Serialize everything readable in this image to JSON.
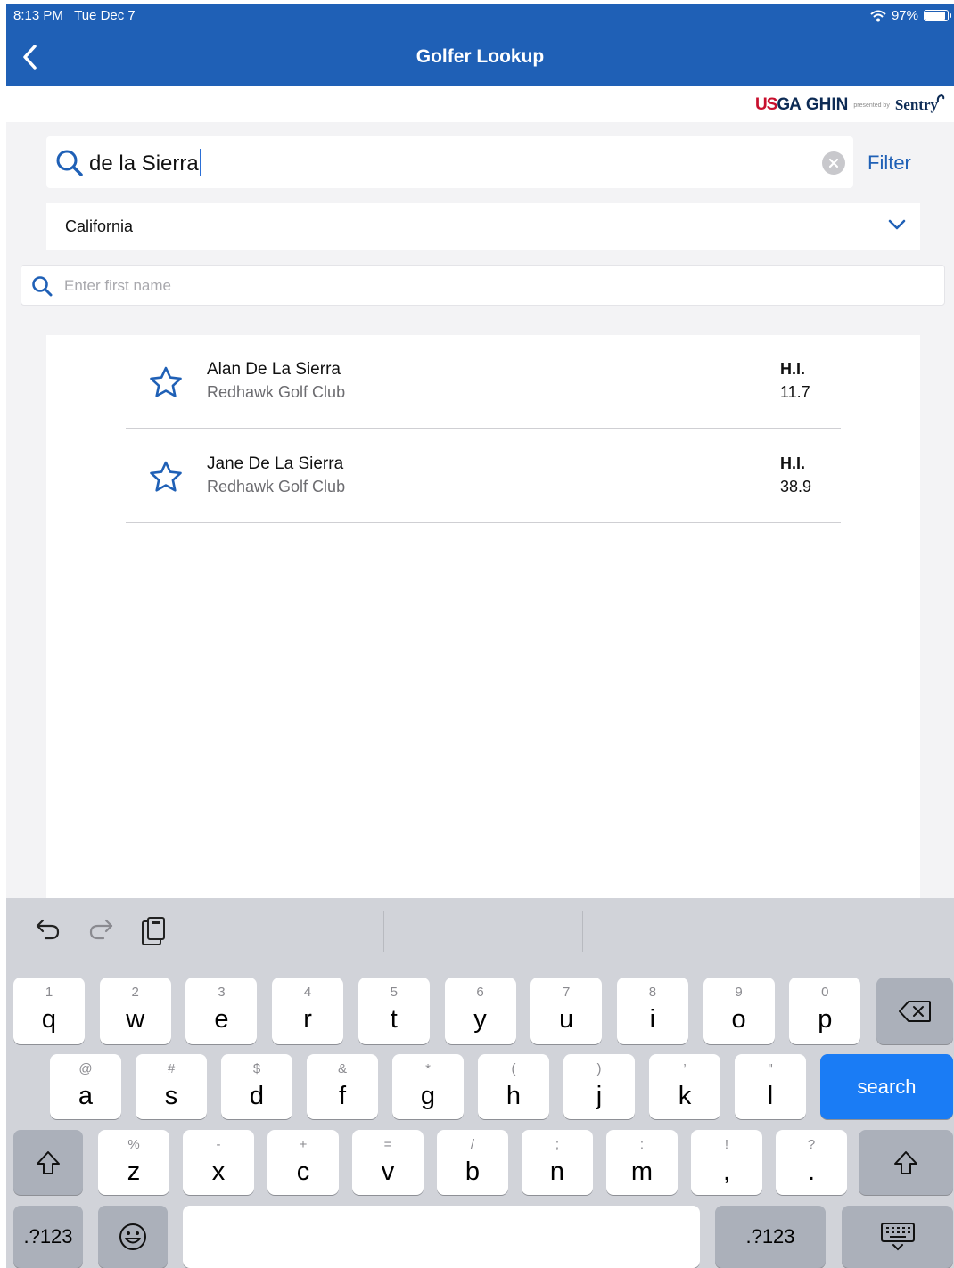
{
  "status_bar": {
    "time": "8:13 PM",
    "date": "Tue Dec 7",
    "battery": "97%",
    "battery_level": 0.97,
    "wifi_icon": "wifi-icon"
  },
  "header": {
    "title": "Golfer Lookup",
    "back_icon": "chevron-left-icon"
  },
  "brand": {
    "usga_us": "US",
    "usga_ga": "GA",
    "ghin": "GHIN",
    "presented_by": "presented by",
    "sentry": "Sentry",
    "colors": {
      "red": "#c8102e",
      "navy": "#0d2b55"
    }
  },
  "search": {
    "value": "de la Sierra",
    "filter_label": "Filter"
  },
  "state_select": {
    "selected": "California"
  },
  "first_name": {
    "placeholder": "Enter first name"
  },
  "results": [
    {
      "name": "Alan De La Sierra",
      "club": "Redhawk Golf Club",
      "hi_label": "H.I.",
      "hi_value": "11.7"
    },
    {
      "name": "Jane De La Sierra",
      "club": "Redhawk Golf Club",
      "hi_label": "H.I.",
      "hi_value": "38.9"
    }
  ],
  "keyboard": {
    "row1": [
      {
        "sub": "1",
        "main": "q"
      },
      {
        "sub": "2",
        "main": "w"
      },
      {
        "sub": "3",
        "main": "e"
      },
      {
        "sub": "4",
        "main": "r"
      },
      {
        "sub": "5",
        "main": "t"
      },
      {
        "sub": "6",
        "main": "y"
      },
      {
        "sub": "7",
        "main": "u"
      },
      {
        "sub": "8",
        "main": "i"
      },
      {
        "sub": "9",
        "main": "o"
      },
      {
        "sub": "0",
        "main": "p"
      }
    ],
    "row2": [
      {
        "sub": "@",
        "main": "a"
      },
      {
        "sub": "#",
        "main": "s"
      },
      {
        "sub": "$",
        "main": "d"
      },
      {
        "sub": "&",
        "main": "f"
      },
      {
        "sub": "*",
        "main": "g"
      },
      {
        "sub": "(",
        "main": "h"
      },
      {
        "sub": ")",
        "main": "j"
      },
      {
        "sub": "’",
        "main": "k"
      },
      {
        "sub": "\"",
        "main": "l"
      }
    ],
    "row3": [
      {
        "sub": "%",
        "main": "z"
      },
      {
        "sub": "-",
        "main": "x"
      },
      {
        "sub": "+",
        "main": "c"
      },
      {
        "sub": "=",
        "main": "v"
      },
      {
        "sub": "/",
        "main": "b"
      },
      {
        "sub": ";",
        "main": "n"
      },
      {
        "sub": ":",
        "main": "m"
      },
      {
        "sub": "!",
        "main": ","
      },
      {
        "sub": "?",
        "main": "."
      }
    ],
    "search_label": "search",
    "numbers_label": ".?123",
    "colors": {
      "accent": "#1a7cf5",
      "header": "#1f60b6"
    }
  }
}
